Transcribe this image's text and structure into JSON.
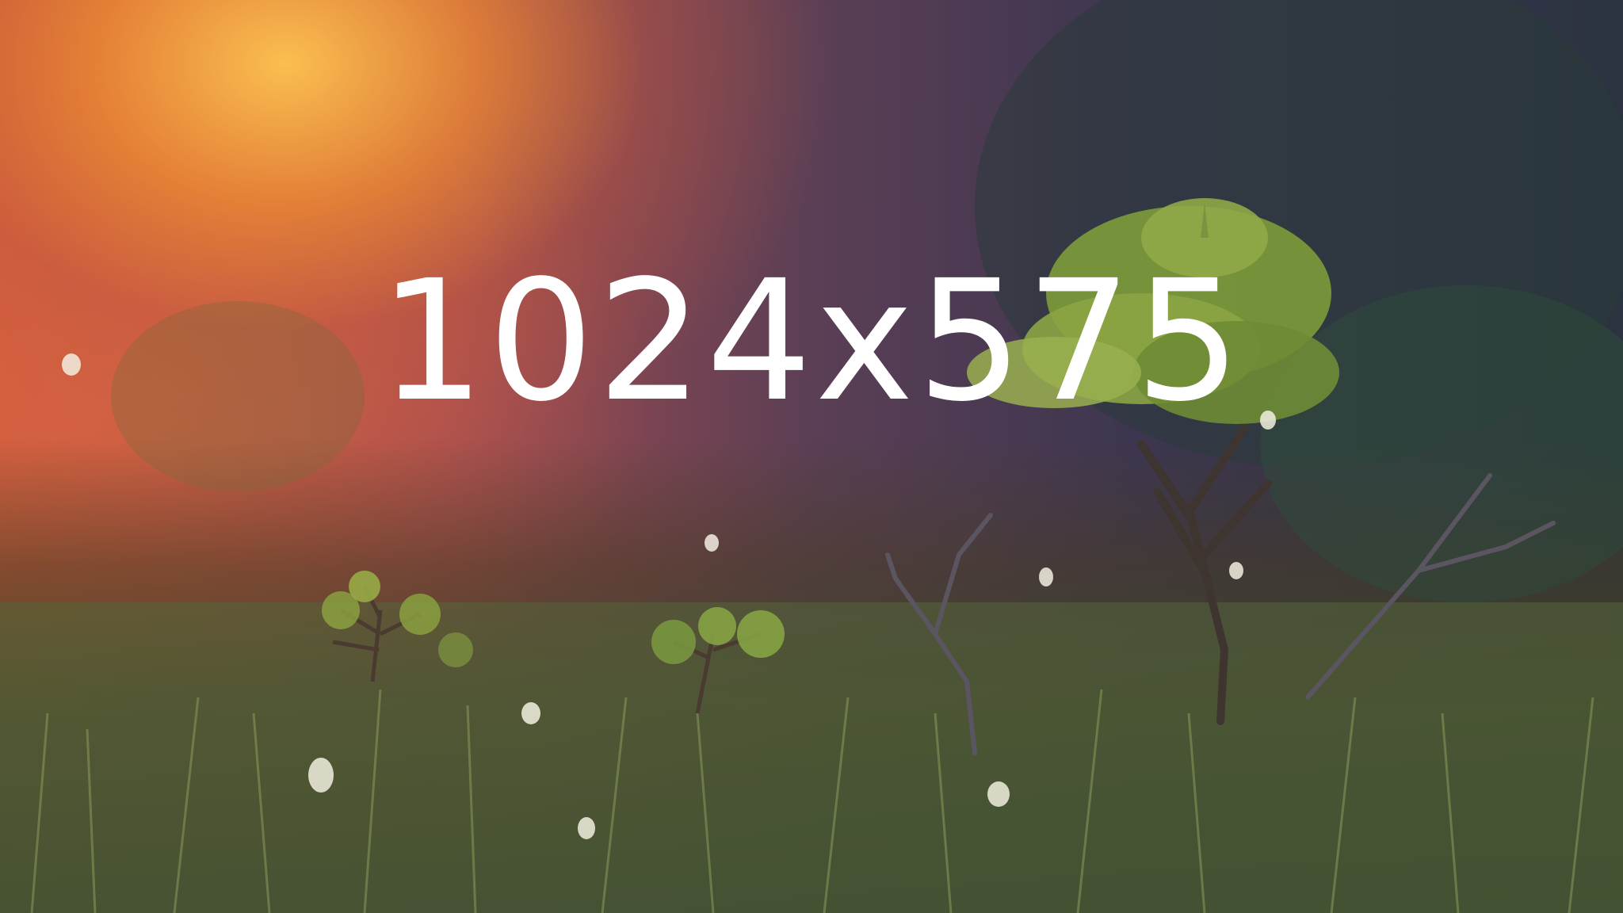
{
  "image": {
    "caption_text": "1024x575"
  },
  "colors": {
    "sun_glow": "#ffc450",
    "warm_haze": "#c9583b",
    "cool_forest": "#2b3340",
    "grass": "#5a6a3a",
    "text": "#ffffff"
  },
  "icons": [
    "small-pine-tree",
    "bare-shrub"
  ]
}
